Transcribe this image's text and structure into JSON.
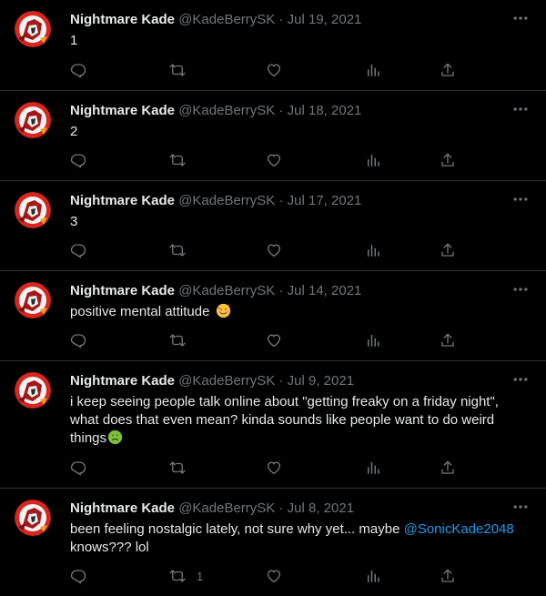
{
  "author": {
    "display_name": "Nightmare Kade",
    "handle": "@KadeBerrySK",
    "separator": "·"
  },
  "icons": {
    "more": "more-horizontal-icon",
    "reply": "reply-icon",
    "retweet": "retweet-icon",
    "like": "heart-icon",
    "views": "views-chart-icon",
    "share": "share-icon"
  },
  "colors": {
    "background": "#000000",
    "text": "#e7e9ea",
    "muted": "#71767b",
    "border": "#2f3336",
    "link": "#1d9bf0"
  },
  "tweets": [
    {
      "date": "Jul 19, 2021",
      "text": "1",
      "retweets": ""
    },
    {
      "date": "Jul 18, 2021",
      "text": "2",
      "retweets": ""
    },
    {
      "date": "Jul 17, 2021",
      "text": "3",
      "retweets": ""
    },
    {
      "date": "Jul 14, 2021",
      "text": "positive mental attitude",
      "emoji": "smiling-face-with-hearts",
      "retweets": ""
    },
    {
      "date": "Jul 9, 2021",
      "text_line1": "i keep seeing people talk online about \"getting freaky on a friday night\",",
      "text_line2": "what does that even mean? kinda sounds like people want to do weird",
      "text_line3": "things",
      "emoji": "nauseated-face",
      "retweets": ""
    },
    {
      "date": "Jul 8, 2021",
      "text_before_mention": "been feeling nostalgic lately, not sure why yet... maybe ",
      "mention": "@SonicKade2048",
      "text_line2": "knows??? lol",
      "retweets": "1"
    }
  ]
}
